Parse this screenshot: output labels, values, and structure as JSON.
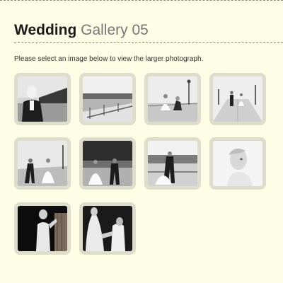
{
  "page": {
    "title_strong": "Wedding",
    "title_light": "Gallery 05",
    "intro": "Please select an image below to view the larger photograph."
  },
  "gallery": {
    "thumbnails": [
      {
        "subject": "groom portrait by the sea"
      },
      {
        "subject": "pier railing and sea"
      },
      {
        "subject": "couple sitting on pier"
      },
      {
        "subject": "couple walking on pier"
      },
      {
        "subject": "couple running on pier"
      },
      {
        "subject": "couple walking by trees"
      },
      {
        "subject": "couple on pier railing"
      },
      {
        "subject": "bride close-up portrait"
      },
      {
        "subject": "bride in dark room"
      },
      {
        "subject": "bride and groom indoors"
      }
    ]
  }
}
